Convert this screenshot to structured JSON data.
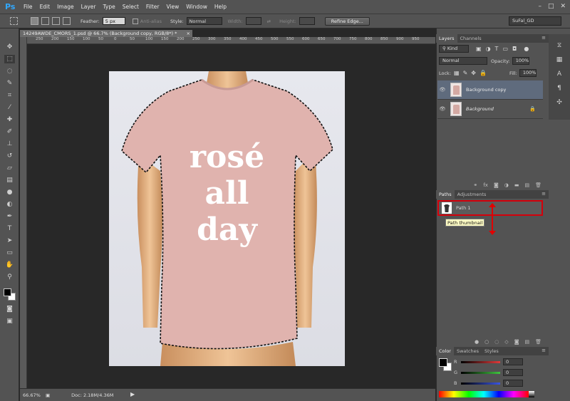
{
  "app": {
    "logo": "Ps",
    "menu": [
      "File",
      "Edit",
      "Image",
      "Layer",
      "Type",
      "Select",
      "Filter",
      "View",
      "Window",
      "Help"
    ],
    "window_controls": [
      "–",
      "□",
      "✕"
    ],
    "workspace": "SuFal_GD"
  },
  "options": {
    "feather_label": "Feather:",
    "feather_value": "5 px",
    "antialias_label": "Anti-alias",
    "style_label": "Style:",
    "style_value": "Normal",
    "width_label": "Width:",
    "height_label": "Height:",
    "refine_label": "Refine Edge..."
  },
  "document": {
    "tab_title": "14249AWDE_CMORS_1.psd @ 66.7% (Background copy, RGB/8*) *",
    "close": "×",
    "ruler_ticks": [
      "250",
      "200",
      "150",
      "100",
      "50",
      "0",
      "50",
      "100",
      "150",
      "200",
      "250",
      "300",
      "350",
      "400",
      "450",
      "500",
      "550",
      "600",
      "650",
      "700",
      "750",
      "800",
      "850",
      "900",
      "950"
    ],
    "shirt_text": [
      "rosé",
      "all",
      "day"
    ]
  },
  "status": {
    "zoom": "66.67%",
    "doc": "Doc: 2.18M/4.36M"
  },
  "layers_panel": {
    "tabs": [
      "Layers",
      "Channels"
    ],
    "kind_label": "Kind",
    "blend_mode": "Normal",
    "opacity_label": "Opacity:",
    "opacity_value": "100%",
    "lock_label": "Lock:",
    "fill_label": "Fill:",
    "fill_value": "100%",
    "layers": [
      {
        "name": "Background copy",
        "active": true
      },
      {
        "name": "Background",
        "active": false
      }
    ]
  },
  "paths_panel": {
    "tabs": [
      "Paths",
      "Adjustments"
    ],
    "paths": [
      {
        "name": "Path 1"
      }
    ],
    "tooltip": "Path thumbnail"
  },
  "color_panel": {
    "tabs": [
      "Color",
      "Swatches",
      "Styles"
    ],
    "channels": [
      {
        "label": "R",
        "value": "0",
        "color": "#e23a3a"
      },
      {
        "label": "G",
        "value": "0",
        "color": "#3fc33f"
      },
      {
        "label": "B",
        "value": "0",
        "color": "#3a55e2"
      }
    ]
  },
  "colors": {
    "accent": "#d4000b",
    "selected_layer": "#5f6b7d",
    "shirt": "#e0b3ae"
  }
}
